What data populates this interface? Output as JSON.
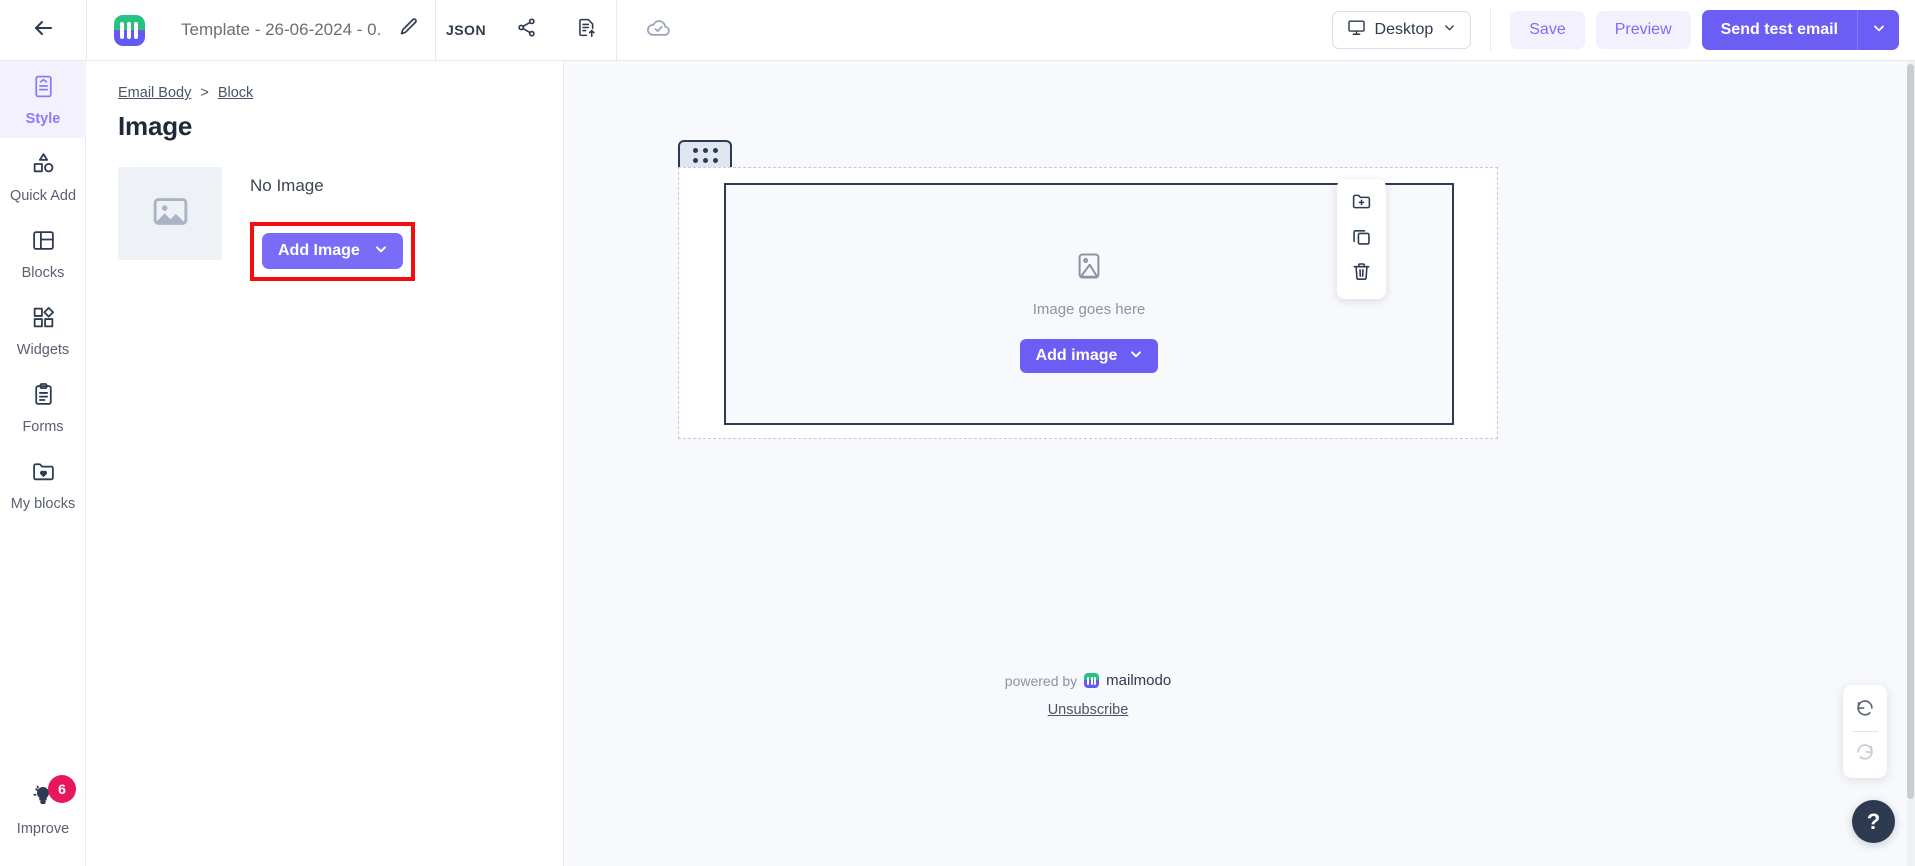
{
  "topbar": {
    "back_icon": "arrow-left-icon",
    "brand_logo": "mailmodo-logo",
    "template_name": "Template - 26-06-2024 - 0...",
    "edit_icon": "pencil-icon",
    "json_label": "JSON",
    "share_icon": "share-icon",
    "export_icon": "export-document-icon",
    "saved_icon": "cloud-check-icon",
    "device": {
      "label": "Desktop",
      "icon": "monitor-icon",
      "caret": "chevron-down-icon"
    },
    "save_label": "Save",
    "preview_label": "Preview",
    "send_test_label": "Send test email",
    "send_caret": "chevron-down-icon"
  },
  "sidebar": {
    "items": [
      {
        "label": "Style",
        "icon": "style-document-icon",
        "active": true
      },
      {
        "label": "Quick Add",
        "icon": "shapes-icon",
        "active": false
      },
      {
        "label": "Blocks",
        "icon": "layout-panel-icon",
        "active": false
      },
      {
        "label": "Widgets",
        "icon": "widgets-grid-icon",
        "active": false
      },
      {
        "label": "Forms",
        "icon": "clipboard-icon",
        "active": false
      },
      {
        "label": "My blocks",
        "icon": "folder-heart-icon",
        "active": false
      }
    ],
    "improve": {
      "label": "Improve",
      "icon": "lightbulb-icon",
      "badge": "6"
    }
  },
  "panel": {
    "breadcrumb": {
      "root": "Email Body",
      "separator": ">",
      "current": "Block"
    },
    "title": "Image",
    "thumbnail_icon": "image-placeholder-icon",
    "no_image_label": "No Image",
    "add_image_label": "Add Image",
    "add_image_caret": "chevron-down-icon",
    "highlight_color": "#f50d0d"
  },
  "canvas": {
    "drag_handle_icon": "drag-dots-icon",
    "block_tools": [
      {
        "icon": "folder-plus-icon"
      },
      {
        "icon": "copy-icon"
      },
      {
        "icon": "trash-icon"
      }
    ],
    "placeholder": {
      "icon": "image-icon",
      "text": "Image goes here",
      "add_image_label": "Add image",
      "add_image_caret": "chevron-down-icon"
    },
    "footer": {
      "powered_by": "powered by",
      "brand": "mailmodo",
      "brand_logo": "mailmodo-mini-logo",
      "unsubscribe": "Unsubscribe"
    }
  },
  "floating": {
    "undo_icon": "undo-icon",
    "redo_icon": "redo-icon",
    "help_label": "?"
  },
  "colors": {
    "accent_purple": "#6c5ef5",
    "accent_purple_light": "#7a6cf7",
    "dark_navy": "#2e3a4f",
    "badge_pink": "#e8175d",
    "canvas_bg": "#f7f9fc",
    "highlight_red": "#f50d0d"
  }
}
